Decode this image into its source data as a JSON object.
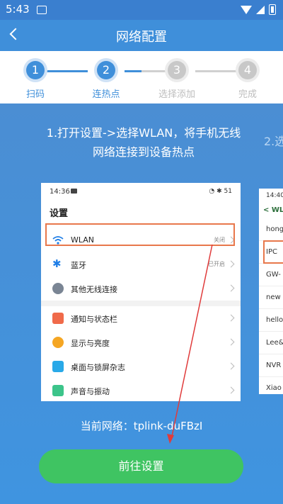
{
  "status_bar": {
    "time": "5:43"
  },
  "header": {
    "title": "网络配置"
  },
  "steps": [
    {
      "num": "1",
      "label": "扫码"
    },
    {
      "num": "2",
      "label": "连热点"
    },
    {
      "num": "3",
      "label": "选择添加"
    },
    {
      "num": "4",
      "label": "完成"
    }
  ],
  "instruction": "1.打开设置->选择WLAN，将手机无线网络连接到设备热点",
  "instruction_next": "2.选",
  "phone": {
    "time": "14:36",
    "status_right": "◔ ✱ 51",
    "title": "设置",
    "rows": [
      {
        "label": "WLAN",
        "value": "关闭"
      },
      {
        "label": "蓝牙",
        "value": "已开启"
      },
      {
        "label": "其他无线连接",
        "value": ""
      },
      {
        "label": "通知与状态栏",
        "value": ""
      },
      {
        "label": "显示与亮度",
        "value": ""
      },
      {
        "label": "桌面与锁屏杂志",
        "value": ""
      },
      {
        "label": "声音与振动",
        "value": ""
      }
    ]
  },
  "phone2": {
    "time": "14:40",
    "header": "< WL",
    "rows": [
      "hong",
      "IPC",
      "GW-",
      "new",
      "hello",
      "Lee&",
      "NVR",
      "Xiao"
    ]
  },
  "current_network": "当前网络：tplink-duFBzI",
  "button": {
    "label": "前往设置"
  },
  "colors": {
    "primary": "#3f8fda",
    "button": "#3fc462",
    "highlight": "#e8774b"
  }
}
